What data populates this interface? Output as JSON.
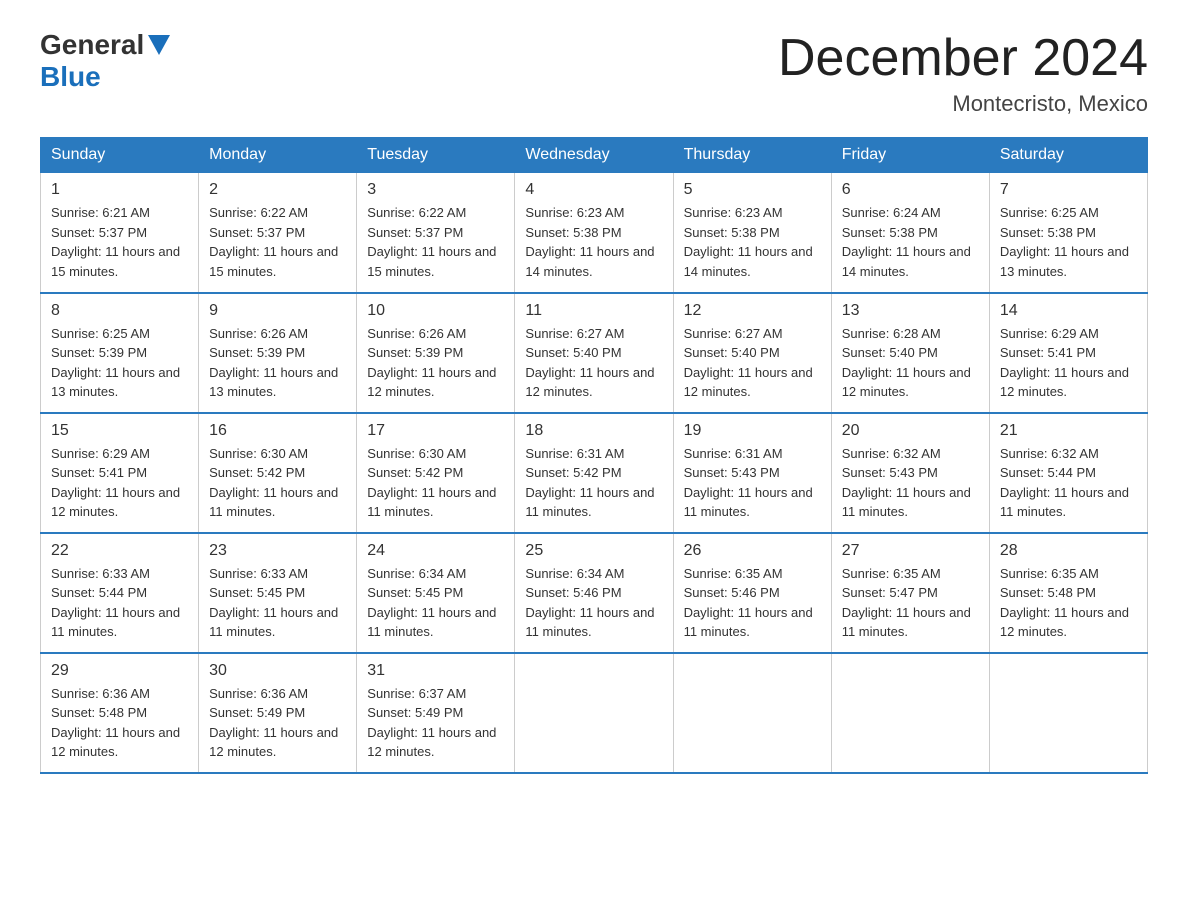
{
  "logo": {
    "line1": "General",
    "line2": "Blue"
  },
  "header": {
    "month": "December 2024",
    "location": "Montecristo, Mexico"
  },
  "weekdays": [
    "Sunday",
    "Monday",
    "Tuesday",
    "Wednesday",
    "Thursday",
    "Friday",
    "Saturday"
  ],
  "weeks": [
    [
      {
        "day": "1",
        "sunrise": "6:21 AM",
        "sunset": "5:37 PM",
        "daylight": "11 hours and 15 minutes."
      },
      {
        "day": "2",
        "sunrise": "6:22 AM",
        "sunset": "5:37 PM",
        "daylight": "11 hours and 15 minutes."
      },
      {
        "day": "3",
        "sunrise": "6:22 AM",
        "sunset": "5:37 PM",
        "daylight": "11 hours and 15 minutes."
      },
      {
        "day": "4",
        "sunrise": "6:23 AM",
        "sunset": "5:38 PM",
        "daylight": "11 hours and 14 minutes."
      },
      {
        "day": "5",
        "sunrise": "6:23 AM",
        "sunset": "5:38 PM",
        "daylight": "11 hours and 14 minutes."
      },
      {
        "day": "6",
        "sunrise": "6:24 AM",
        "sunset": "5:38 PM",
        "daylight": "11 hours and 14 minutes."
      },
      {
        "day": "7",
        "sunrise": "6:25 AM",
        "sunset": "5:38 PM",
        "daylight": "11 hours and 13 minutes."
      }
    ],
    [
      {
        "day": "8",
        "sunrise": "6:25 AM",
        "sunset": "5:39 PM",
        "daylight": "11 hours and 13 minutes."
      },
      {
        "day": "9",
        "sunrise": "6:26 AM",
        "sunset": "5:39 PM",
        "daylight": "11 hours and 13 minutes."
      },
      {
        "day": "10",
        "sunrise": "6:26 AM",
        "sunset": "5:39 PM",
        "daylight": "11 hours and 12 minutes."
      },
      {
        "day": "11",
        "sunrise": "6:27 AM",
        "sunset": "5:40 PM",
        "daylight": "11 hours and 12 minutes."
      },
      {
        "day": "12",
        "sunrise": "6:27 AM",
        "sunset": "5:40 PM",
        "daylight": "11 hours and 12 minutes."
      },
      {
        "day": "13",
        "sunrise": "6:28 AM",
        "sunset": "5:40 PM",
        "daylight": "11 hours and 12 minutes."
      },
      {
        "day": "14",
        "sunrise": "6:29 AM",
        "sunset": "5:41 PM",
        "daylight": "11 hours and 12 minutes."
      }
    ],
    [
      {
        "day": "15",
        "sunrise": "6:29 AM",
        "sunset": "5:41 PM",
        "daylight": "11 hours and 12 minutes."
      },
      {
        "day": "16",
        "sunrise": "6:30 AM",
        "sunset": "5:42 PM",
        "daylight": "11 hours and 11 minutes."
      },
      {
        "day": "17",
        "sunrise": "6:30 AM",
        "sunset": "5:42 PM",
        "daylight": "11 hours and 11 minutes."
      },
      {
        "day": "18",
        "sunrise": "6:31 AM",
        "sunset": "5:42 PM",
        "daylight": "11 hours and 11 minutes."
      },
      {
        "day": "19",
        "sunrise": "6:31 AM",
        "sunset": "5:43 PM",
        "daylight": "11 hours and 11 minutes."
      },
      {
        "day": "20",
        "sunrise": "6:32 AM",
        "sunset": "5:43 PM",
        "daylight": "11 hours and 11 minutes."
      },
      {
        "day": "21",
        "sunrise": "6:32 AM",
        "sunset": "5:44 PM",
        "daylight": "11 hours and 11 minutes."
      }
    ],
    [
      {
        "day": "22",
        "sunrise": "6:33 AM",
        "sunset": "5:44 PM",
        "daylight": "11 hours and 11 minutes."
      },
      {
        "day": "23",
        "sunrise": "6:33 AM",
        "sunset": "5:45 PM",
        "daylight": "11 hours and 11 minutes."
      },
      {
        "day": "24",
        "sunrise": "6:34 AM",
        "sunset": "5:45 PM",
        "daylight": "11 hours and 11 minutes."
      },
      {
        "day": "25",
        "sunrise": "6:34 AM",
        "sunset": "5:46 PM",
        "daylight": "11 hours and 11 minutes."
      },
      {
        "day": "26",
        "sunrise": "6:35 AM",
        "sunset": "5:46 PM",
        "daylight": "11 hours and 11 minutes."
      },
      {
        "day": "27",
        "sunrise": "6:35 AM",
        "sunset": "5:47 PM",
        "daylight": "11 hours and 11 minutes."
      },
      {
        "day": "28",
        "sunrise": "6:35 AM",
        "sunset": "5:48 PM",
        "daylight": "11 hours and 12 minutes."
      }
    ],
    [
      {
        "day": "29",
        "sunrise": "6:36 AM",
        "sunset": "5:48 PM",
        "daylight": "11 hours and 12 minutes."
      },
      {
        "day": "30",
        "sunrise": "6:36 AM",
        "sunset": "5:49 PM",
        "daylight": "11 hours and 12 minutes."
      },
      {
        "day": "31",
        "sunrise": "6:37 AM",
        "sunset": "5:49 PM",
        "daylight": "11 hours and 12 minutes."
      },
      null,
      null,
      null,
      null
    ]
  ],
  "labels": {
    "sunrise": "Sunrise:",
    "sunset": "Sunset:",
    "daylight": "Daylight:"
  }
}
